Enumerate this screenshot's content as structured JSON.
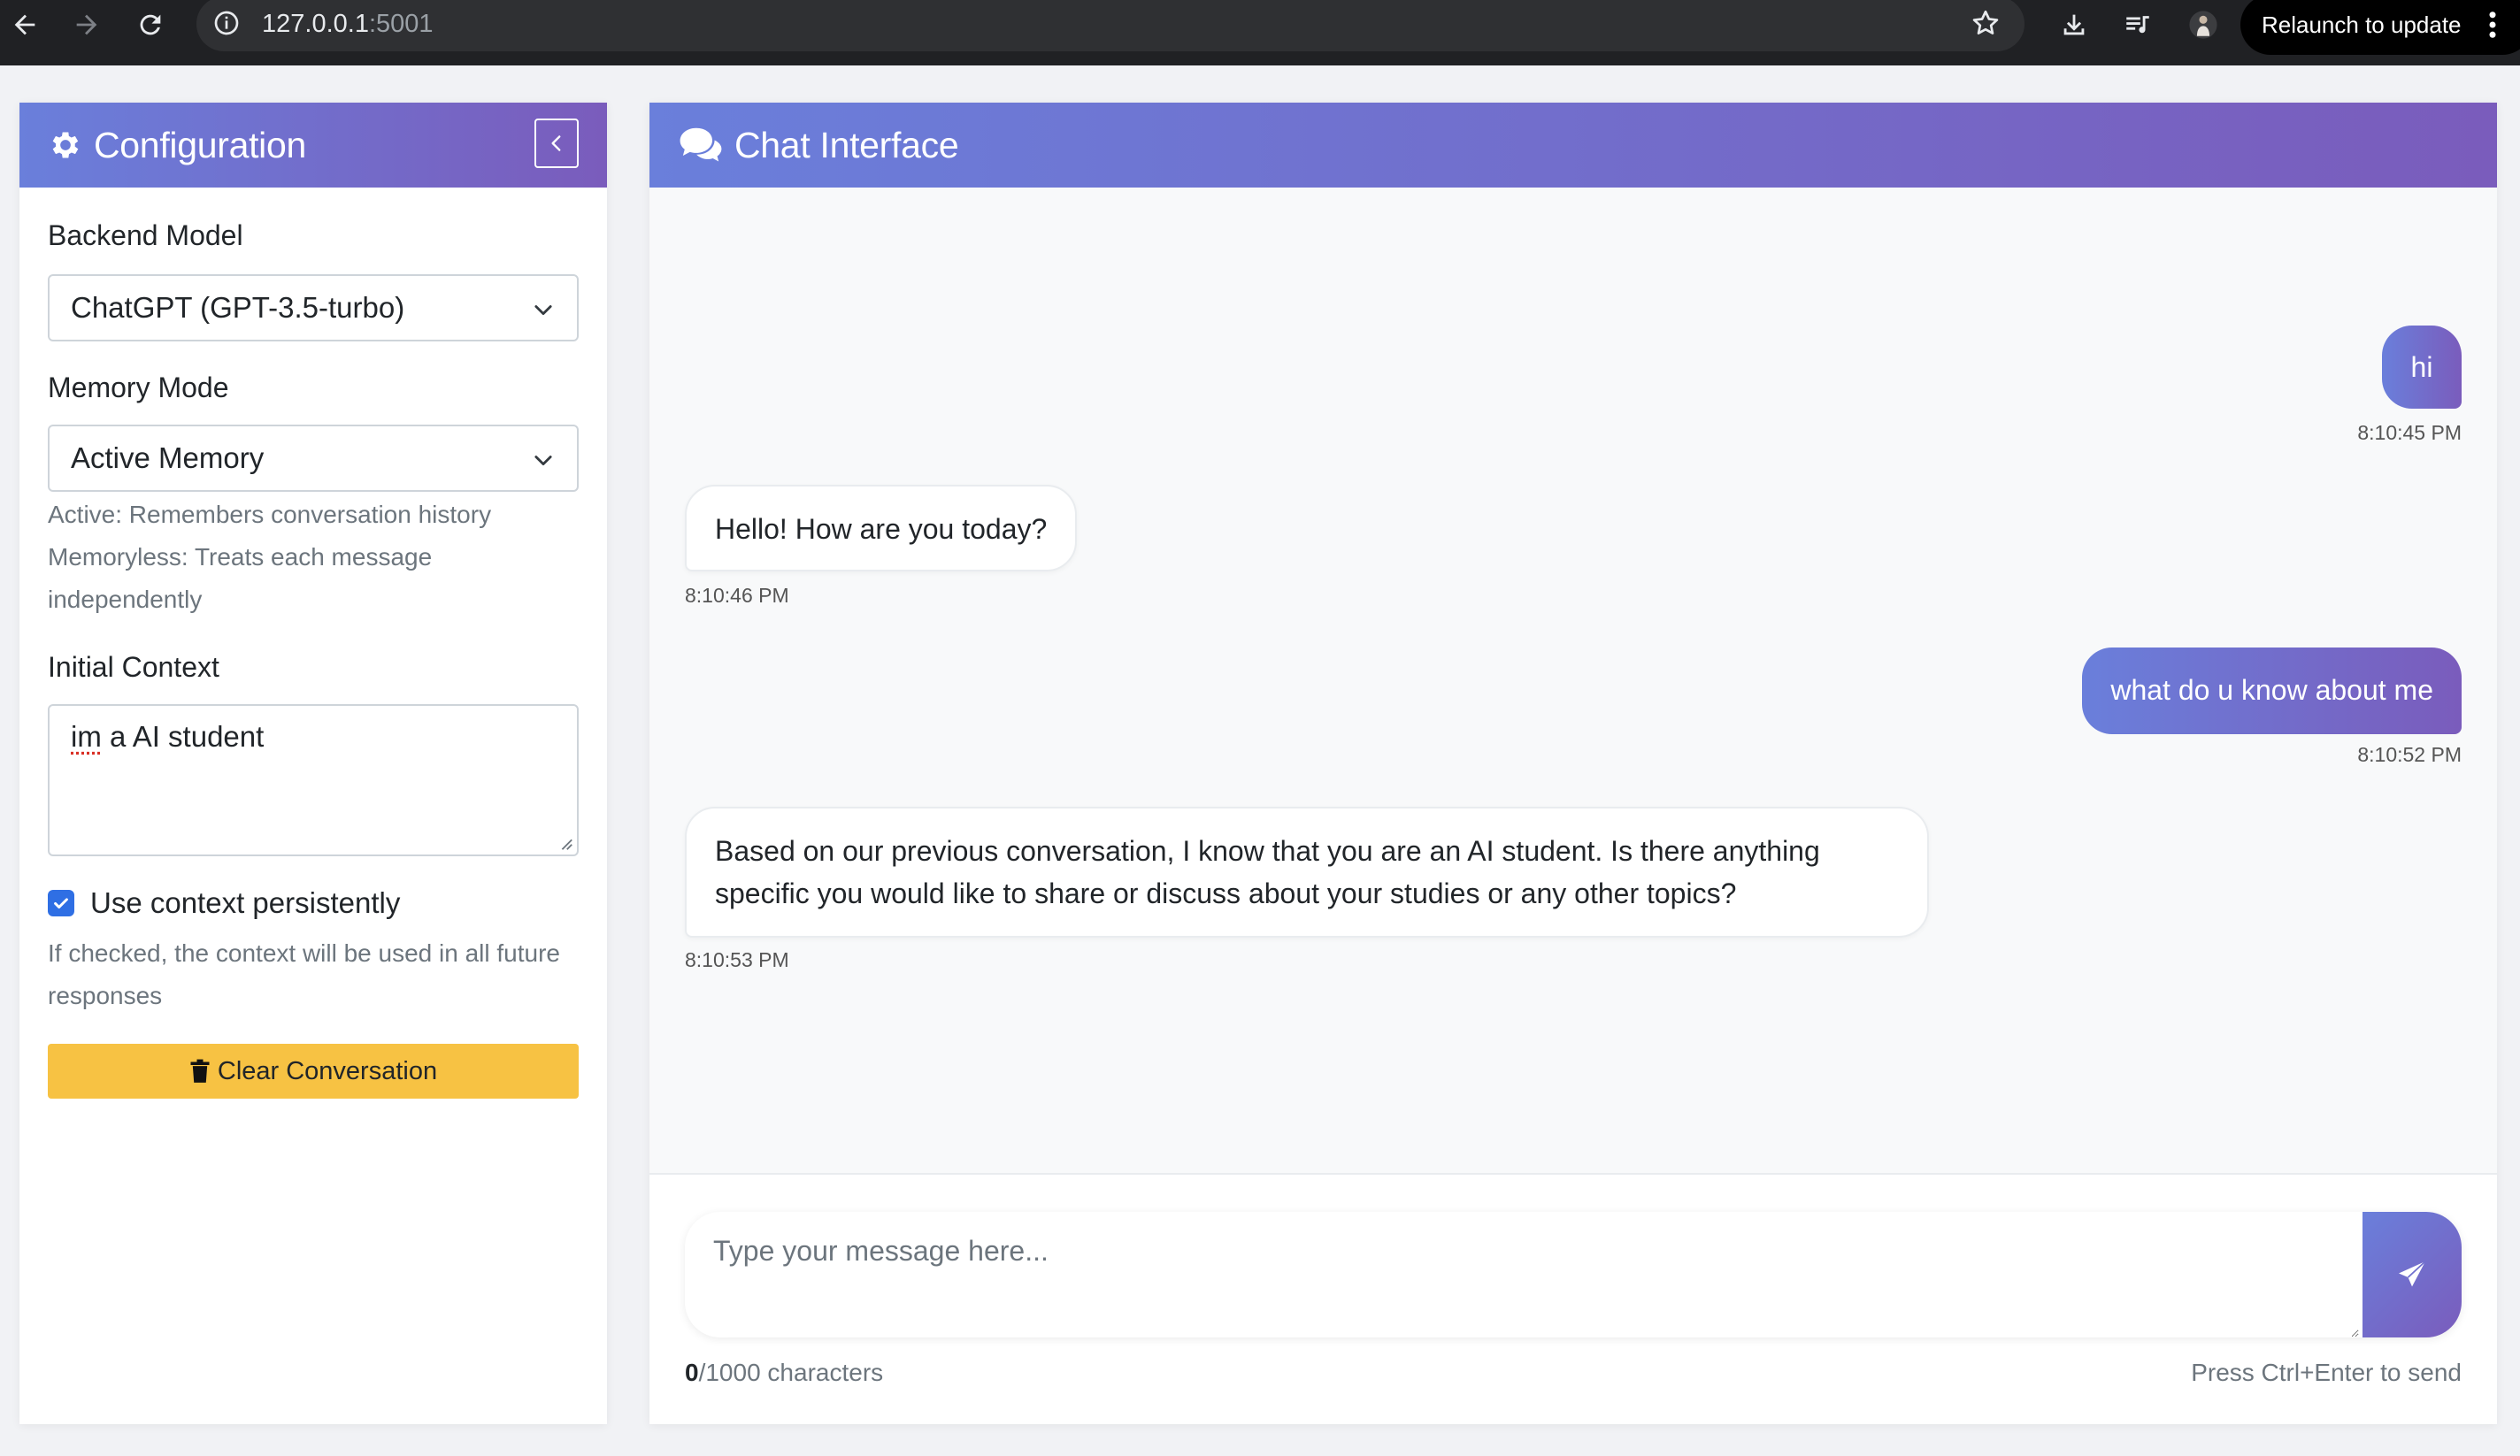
{
  "browser": {
    "url_host": "127.0.0.1",
    "url_port": ":5001",
    "relaunch_label": "Relaunch to update"
  },
  "config": {
    "title": "Configuration",
    "backend_label": "Backend Model",
    "backend_value": "ChatGPT (GPT-3.5-turbo)",
    "memory_label": "Memory Mode",
    "memory_value": "Active Memory",
    "memory_help_active": "Active: Remembers conversation history",
    "memory_help_memoryless": "Memoryless: Treats each message independently",
    "context_label": "Initial Context",
    "context_value_word": "im",
    "context_value_rest": " a AI student",
    "persist_label": "Use context persistently",
    "persist_checked": true,
    "persist_help": "If checked, the context will be used in all future responses",
    "clear_label": "Clear Conversation"
  },
  "chat": {
    "title": "Chat Interface",
    "messages": [
      {
        "role": "user",
        "text": "hi",
        "time": "8:10:45 PM"
      },
      {
        "role": "bot",
        "text": "Hello! How are you today?",
        "time": "8:10:46 PM"
      },
      {
        "role": "user",
        "text": "what do u know about me",
        "time": "8:10:52 PM"
      },
      {
        "role": "bot",
        "text": "Based on our previous conversation, I know that you are an AI student. Is there anything specific you would like to share or discuss about your studies or any other topics?",
        "time": "8:10:53 PM"
      }
    ],
    "input_placeholder": "Type your message here...",
    "char_count": "0",
    "char_limit_text": "/1000 characters",
    "send_hint": "Press Ctrl+Enter to send"
  },
  "colors": {
    "header_gradient_start": "#6a7fdb",
    "header_gradient_end": "#7a5cbc",
    "clear_button": "#f7c243",
    "checkbox": "#2f6fe4"
  },
  "icons": [
    "back-arrow-icon",
    "forward-arrow-icon",
    "reload-icon",
    "info-icon",
    "star-icon",
    "download-icon",
    "media-queue-icon",
    "profile-avatar",
    "kebab-menu-icon",
    "gear-icon",
    "chevron-left-icon",
    "chevron-down-icon",
    "check-icon",
    "trash-icon",
    "comments-icon",
    "send-icon"
  ]
}
